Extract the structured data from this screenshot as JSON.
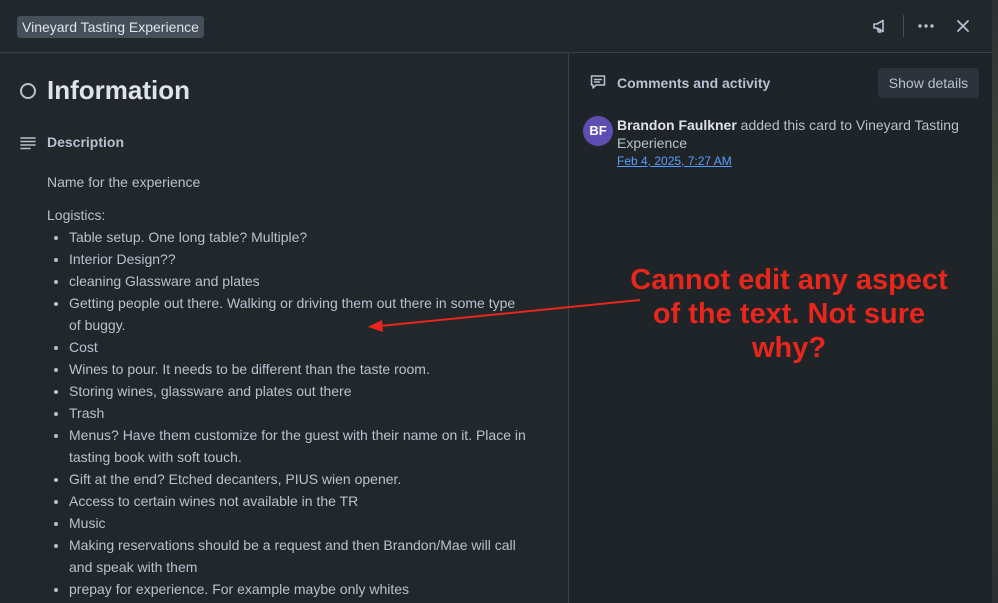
{
  "card": {
    "board_name": "Vineyard Tasting Experience",
    "title": "Information"
  },
  "description": {
    "heading": "Description",
    "intro": "Name for the experience",
    "logistics_label": "Logistics:",
    "items": [
      "Table setup. One long table? Multiple?",
      "Interior Design??",
      "cleaning Glassware and plates",
      "Getting people out there. Walking or driving them out there in some type of buggy.",
      "Cost",
      "Wines to pour. It needs to be different than the taste room.",
      "Storing wines, glassware and plates out there",
      "Trash",
      "Menus? Have them customize for the guest with their name on it. Place in tasting book with soft touch.",
      "Gift at the end? Etched decanters, PIUS wien opener.",
      "Access to certain wines not available in the TR",
      "Music",
      "Making reservations should be a request and then Brandon/Mae will call and speak with them",
      "prepay for experience. For example maybe only whites"
    ]
  },
  "activity": {
    "heading": "Comments and activity",
    "show_details_label": "Show details",
    "entry": {
      "avatar_initials": "BF",
      "user": "Brandon Faulkner",
      "action": " added this card to Vineyard Tasting Experience",
      "timestamp": "Feb 4, 2025, 7:27 AM"
    }
  },
  "annotation": {
    "text": "Cannot edit any aspect of the text. Not sure why?"
  },
  "icons": {
    "announce": "megaphone-icon",
    "more": "more-horizontal-icon",
    "close": "close-icon",
    "status": "circle-outline-icon",
    "description": "text-lines-icon",
    "comments": "comment-icon"
  },
  "colors": {
    "annotation": "#e8261b",
    "avatar": "#5e4db2",
    "link": "#579dff"
  }
}
